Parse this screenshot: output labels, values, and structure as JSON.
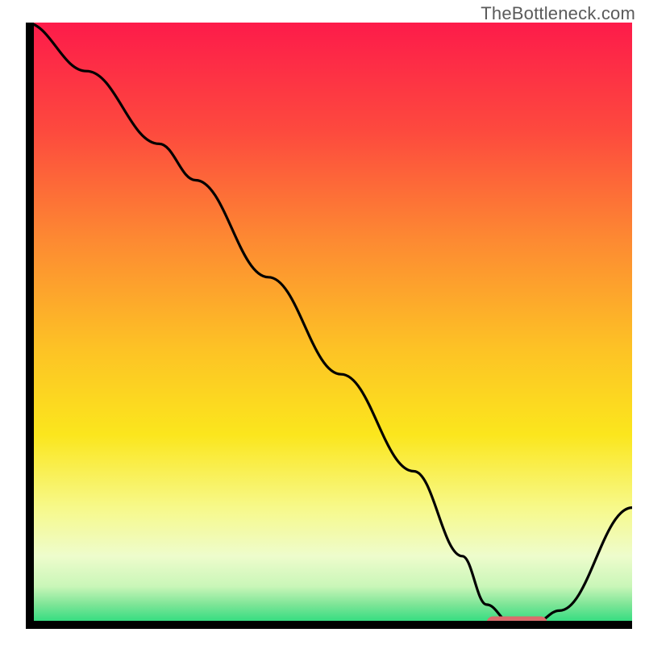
{
  "watermark": "TheBottleneck.com",
  "chart_data": {
    "type": "line",
    "title": "",
    "xlabel": "",
    "ylabel": "",
    "xlim": [
      0,
      100
    ],
    "ylim": [
      0,
      100
    ],
    "grid": false,
    "series": [
      {
        "name": "curve",
        "x": [
          0,
          10,
          22,
          28,
          40,
          52,
          64,
          72,
          76,
          80,
          84,
          88,
          100
        ],
        "values": [
          100,
          92,
          80,
          74,
          58,
          42,
          26,
          12,
          4,
          1,
          1,
          3,
          20
        ]
      }
    ],
    "annotations": [
      {
        "type": "marker",
        "name": "optimal-zone",
        "shape": "rounded-bar",
        "color": "#da6c6c",
        "x_range": [
          76,
          86
        ],
        "y": 1
      }
    ],
    "gradient_stops": [
      {
        "offset": 0.0,
        "color": "#fd1b4a"
      },
      {
        "offset": 0.18,
        "color": "#fd4a3e"
      },
      {
        "offset": 0.36,
        "color": "#fd8a32"
      },
      {
        "offset": 0.54,
        "color": "#fdc325"
      },
      {
        "offset": 0.68,
        "color": "#fbe61d"
      },
      {
        "offset": 0.8,
        "color": "#f7f98a"
      },
      {
        "offset": 0.88,
        "color": "#eefccc"
      },
      {
        "offset": 0.93,
        "color": "#c9f6b8"
      },
      {
        "offset": 0.96,
        "color": "#7de597"
      },
      {
        "offset": 1.0,
        "color": "#14d977"
      }
    ]
  }
}
